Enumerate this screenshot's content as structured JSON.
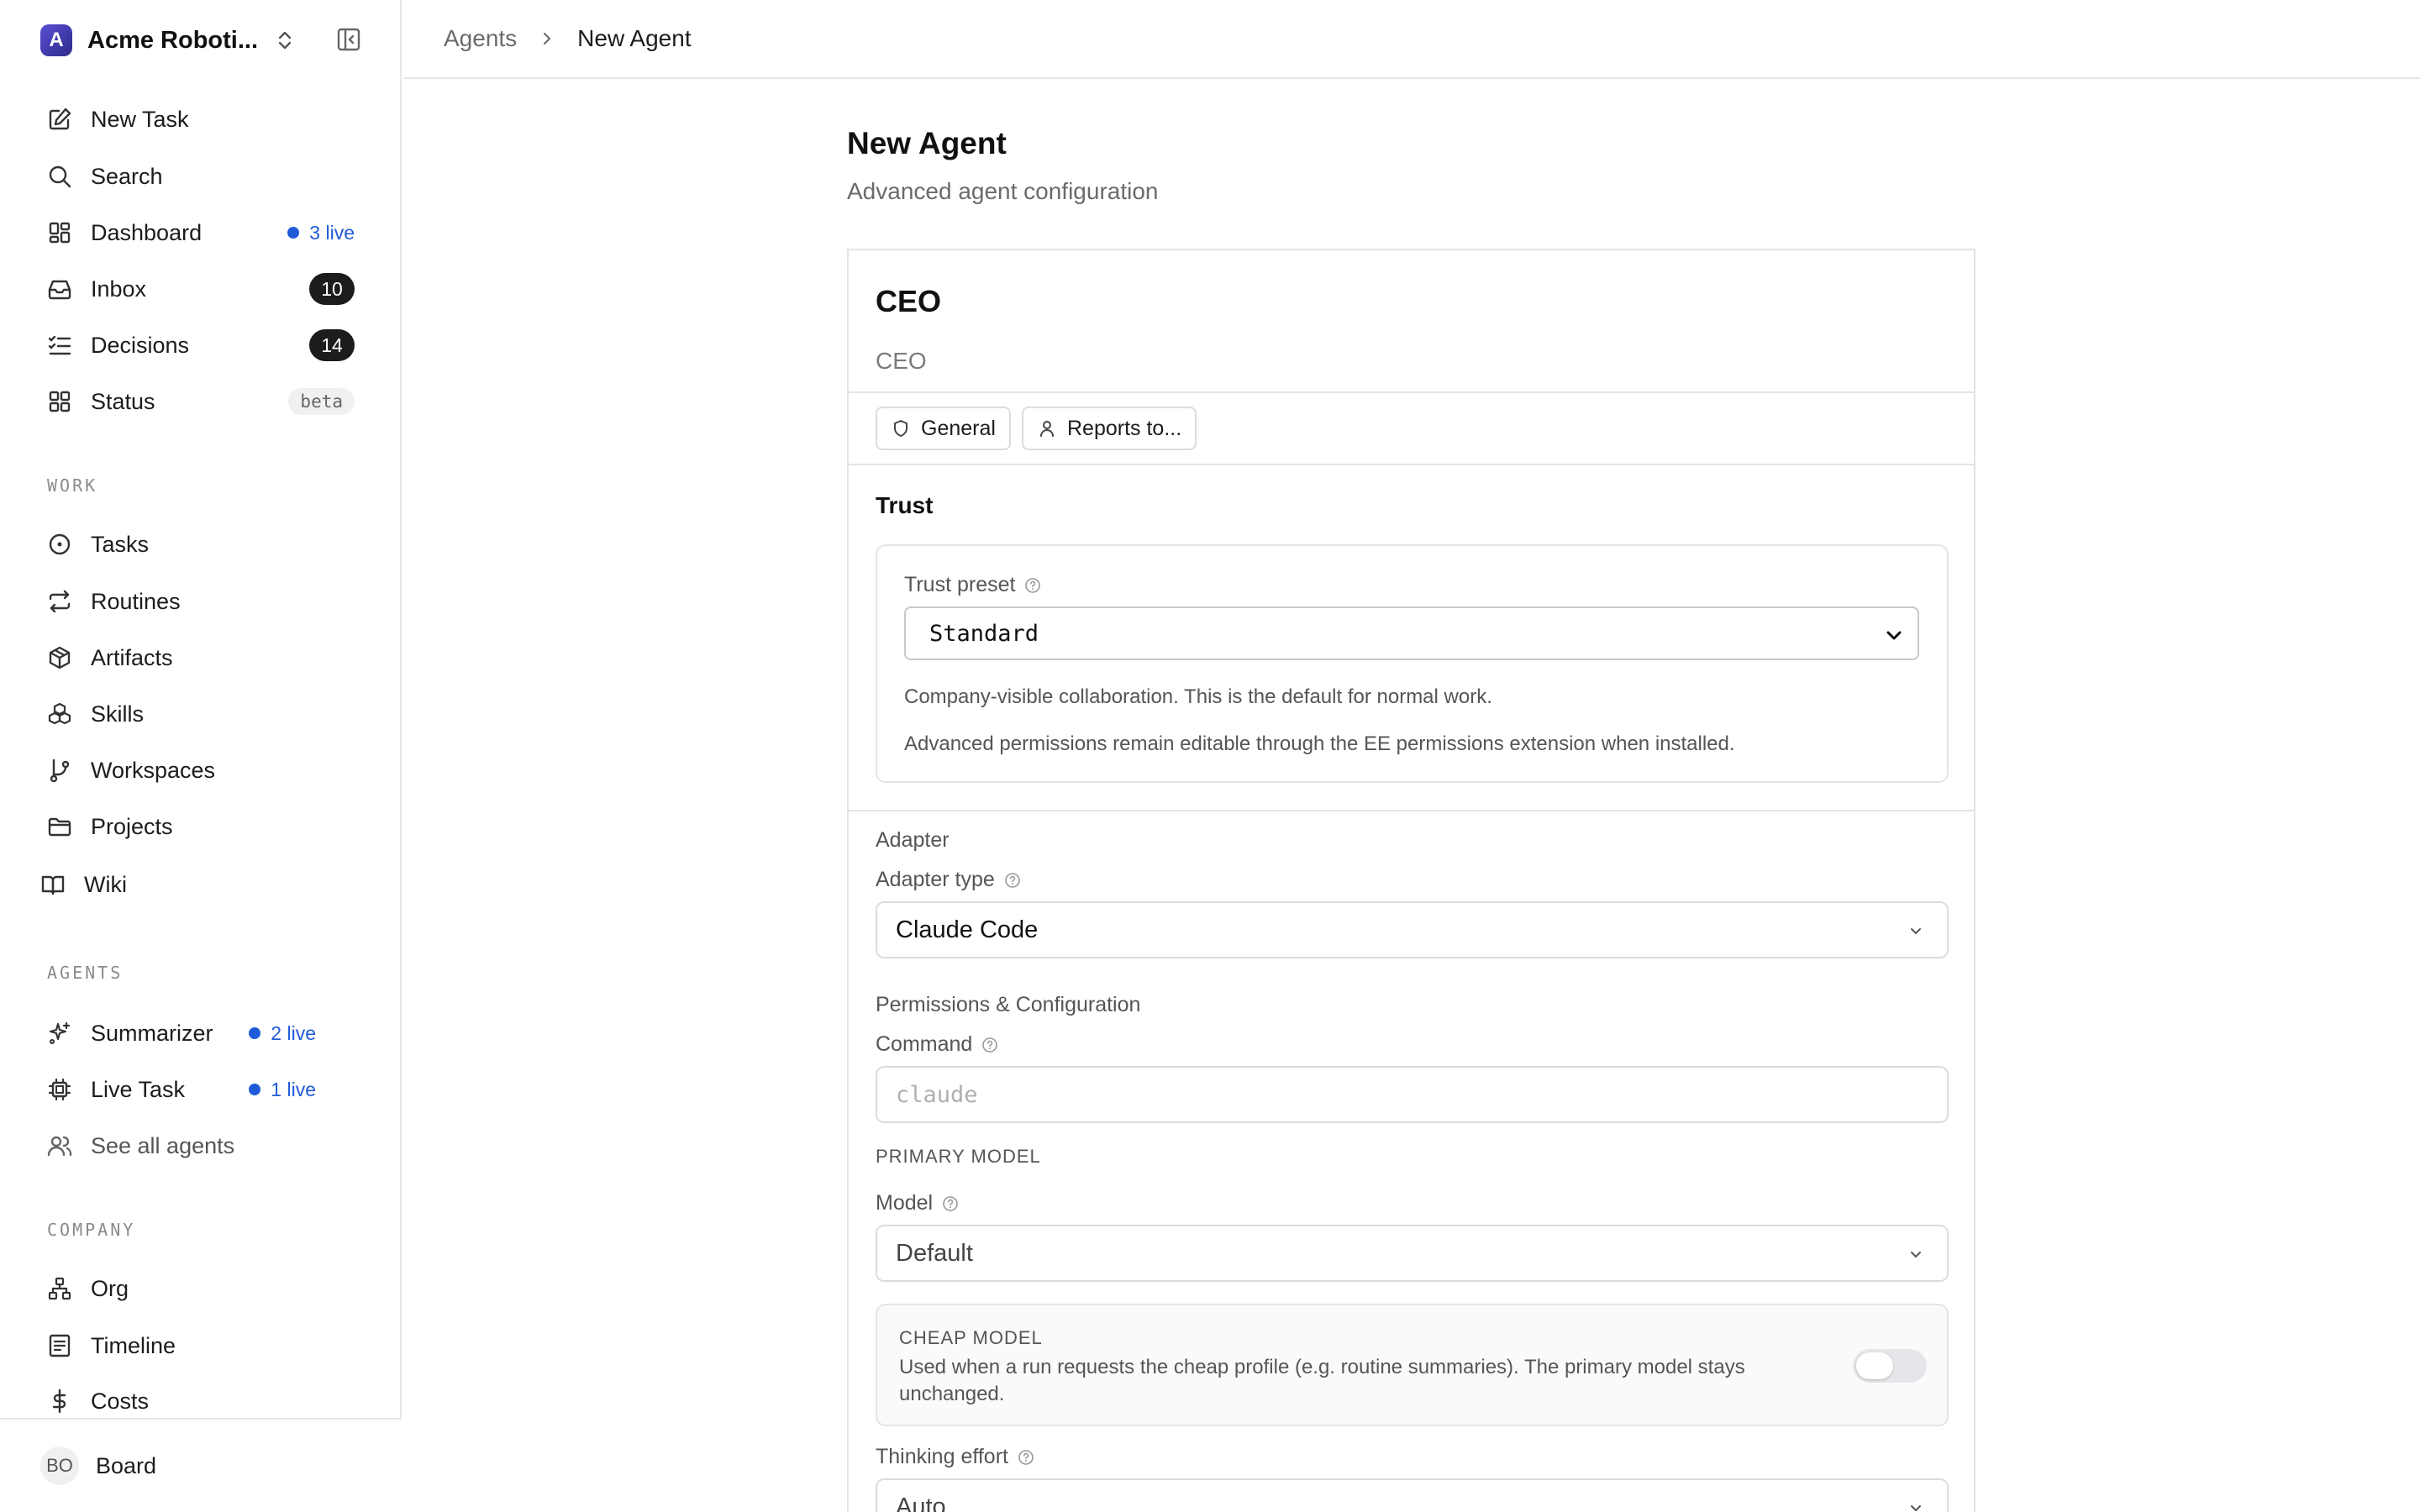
{
  "workspace": {
    "name": "Acme Roboti...",
    "logo_letter": "A"
  },
  "sidebar": {
    "main_items": [
      {
        "label": "New Task"
      },
      {
        "label": "Search"
      },
      {
        "label": "Dashboard",
        "live": "3 live"
      },
      {
        "label": "Inbox",
        "count": "10"
      },
      {
        "label": "Decisions",
        "count": "14"
      },
      {
        "label": "Status",
        "badge": "beta"
      }
    ],
    "work_heading": "WORK",
    "work_items": [
      {
        "label": "Tasks"
      },
      {
        "label": "Routines"
      },
      {
        "label": "Artifacts"
      },
      {
        "label": "Skills"
      },
      {
        "label": "Workspaces"
      },
      {
        "label": "Projects"
      },
      {
        "label": "Wiki"
      }
    ],
    "agents_heading": "AGENTS",
    "agent_items": [
      {
        "label": "Summarizer",
        "live": "2 live"
      },
      {
        "label": "Live Task",
        "live": "1 live"
      },
      {
        "label": "See all agents"
      }
    ],
    "company_heading": "COMPANY",
    "company_items": [
      {
        "label": "Org"
      },
      {
        "label": "Timeline"
      },
      {
        "label": "Costs"
      }
    ],
    "footer": {
      "initials": "BO",
      "label": "Board"
    }
  },
  "breadcrumb": {
    "parent": "Agents",
    "current": "New Agent"
  },
  "page": {
    "title": "New Agent",
    "subtitle": "Advanced agent configuration"
  },
  "agent": {
    "name": "CEO",
    "title": "CEO"
  },
  "chips": {
    "general": "General",
    "reports_to": "Reports to..."
  },
  "trust": {
    "heading": "Trust",
    "preset_label": "Trust preset",
    "preset_value": "Standard",
    "description": "Company-visible collaboration. This is the default for normal work.",
    "note": "Advanced permissions remain editable through the EE permissions extension when installed."
  },
  "adapter": {
    "heading": "Adapter",
    "type_label": "Adapter type",
    "type_value": "Claude Code"
  },
  "permissions": {
    "heading": "Permissions & Configuration",
    "command_label": "Command",
    "command_placeholder": "claude",
    "primary_model_heading": "PRIMARY MODEL",
    "model_label": "Model",
    "model_value": "Default",
    "cheap_model_heading": "CHEAP MODEL",
    "cheap_model_desc": "Used when a run requests the cheap profile (e.g. routine summaries). The primary model stays unchanged.",
    "cheap_model_enabled": false,
    "thinking_label": "Thinking effort",
    "thinking_value": "Auto"
  },
  "colors": {
    "accent_blue": "#1f5bd8",
    "badge_dark": "#1c1c1e",
    "border": "#e4e4e7"
  }
}
